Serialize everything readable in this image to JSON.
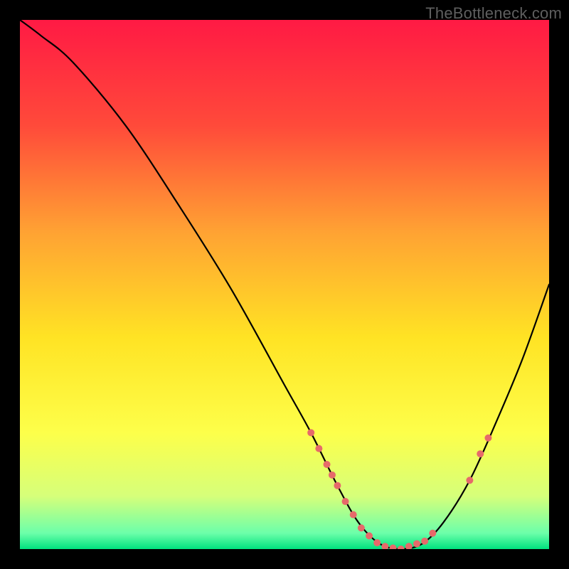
{
  "watermark": "TheBottleneck.com",
  "chart_data": {
    "type": "line",
    "title": "",
    "xlabel": "",
    "ylabel": "",
    "xlim": [
      0,
      100
    ],
    "ylim": [
      0,
      100
    ],
    "background_gradient": {
      "stops": [
        {
          "offset": 0,
          "color": "#ff1a44"
        },
        {
          "offset": 20,
          "color": "#ff4a3a"
        },
        {
          "offset": 40,
          "color": "#ffa233"
        },
        {
          "offset": 60,
          "color": "#ffe324"
        },
        {
          "offset": 78,
          "color": "#fdff4a"
        },
        {
          "offset": 90,
          "color": "#d6ff7a"
        },
        {
          "offset": 97,
          "color": "#6cffaa"
        },
        {
          "offset": 100,
          "color": "#00e27e"
        }
      ]
    },
    "series": [
      {
        "name": "bottleneck-curve",
        "x": [
          0,
          4,
          10,
          20,
          30,
          40,
          50,
          55,
          60,
          64,
          68,
          72,
          76,
          80,
          85,
          90,
          95,
          100
        ],
        "y": [
          100,
          97,
          92,
          80,
          65,
          49,
          31,
          22,
          12,
          5,
          1,
          0,
          1,
          5,
          13,
          24,
          36,
          50
        ]
      }
    ],
    "markers": {
      "name": "highlight-points",
      "color": "#e66a6a",
      "points": [
        {
          "x": 55.0,
          "y": 22.0,
          "r": 5
        },
        {
          "x": 56.5,
          "y": 19.0,
          "r": 5
        },
        {
          "x": 58.0,
          "y": 16.0,
          "r": 5
        },
        {
          "x": 59.0,
          "y": 14.0,
          "r": 5
        },
        {
          "x": 60.0,
          "y": 12.0,
          "r": 5
        },
        {
          "x": 61.5,
          "y": 9.0,
          "r": 5
        },
        {
          "x": 63.0,
          "y": 6.5,
          "r": 5
        },
        {
          "x": 64.5,
          "y": 4.0,
          "r": 5
        },
        {
          "x": 66.0,
          "y": 2.5,
          "r": 5
        },
        {
          "x": 67.5,
          "y": 1.2,
          "r": 5
        },
        {
          "x": 69.0,
          "y": 0.5,
          "r": 5
        },
        {
          "x": 70.5,
          "y": 0.2,
          "r": 5
        },
        {
          "x": 72.0,
          "y": 0.0,
          "r": 5
        },
        {
          "x": 73.5,
          "y": 0.5,
          "r": 5
        },
        {
          "x": 75.0,
          "y": 1.0,
          "r": 5
        },
        {
          "x": 76.5,
          "y": 1.5,
          "r": 5
        },
        {
          "x": 78.0,
          "y": 3.0,
          "r": 5
        },
        {
          "x": 85.0,
          "y": 13.0,
          "r": 5
        },
        {
          "x": 87.0,
          "y": 18.0,
          "r": 5
        },
        {
          "x": 88.5,
          "y": 21.0,
          "r": 5
        }
      ]
    }
  }
}
